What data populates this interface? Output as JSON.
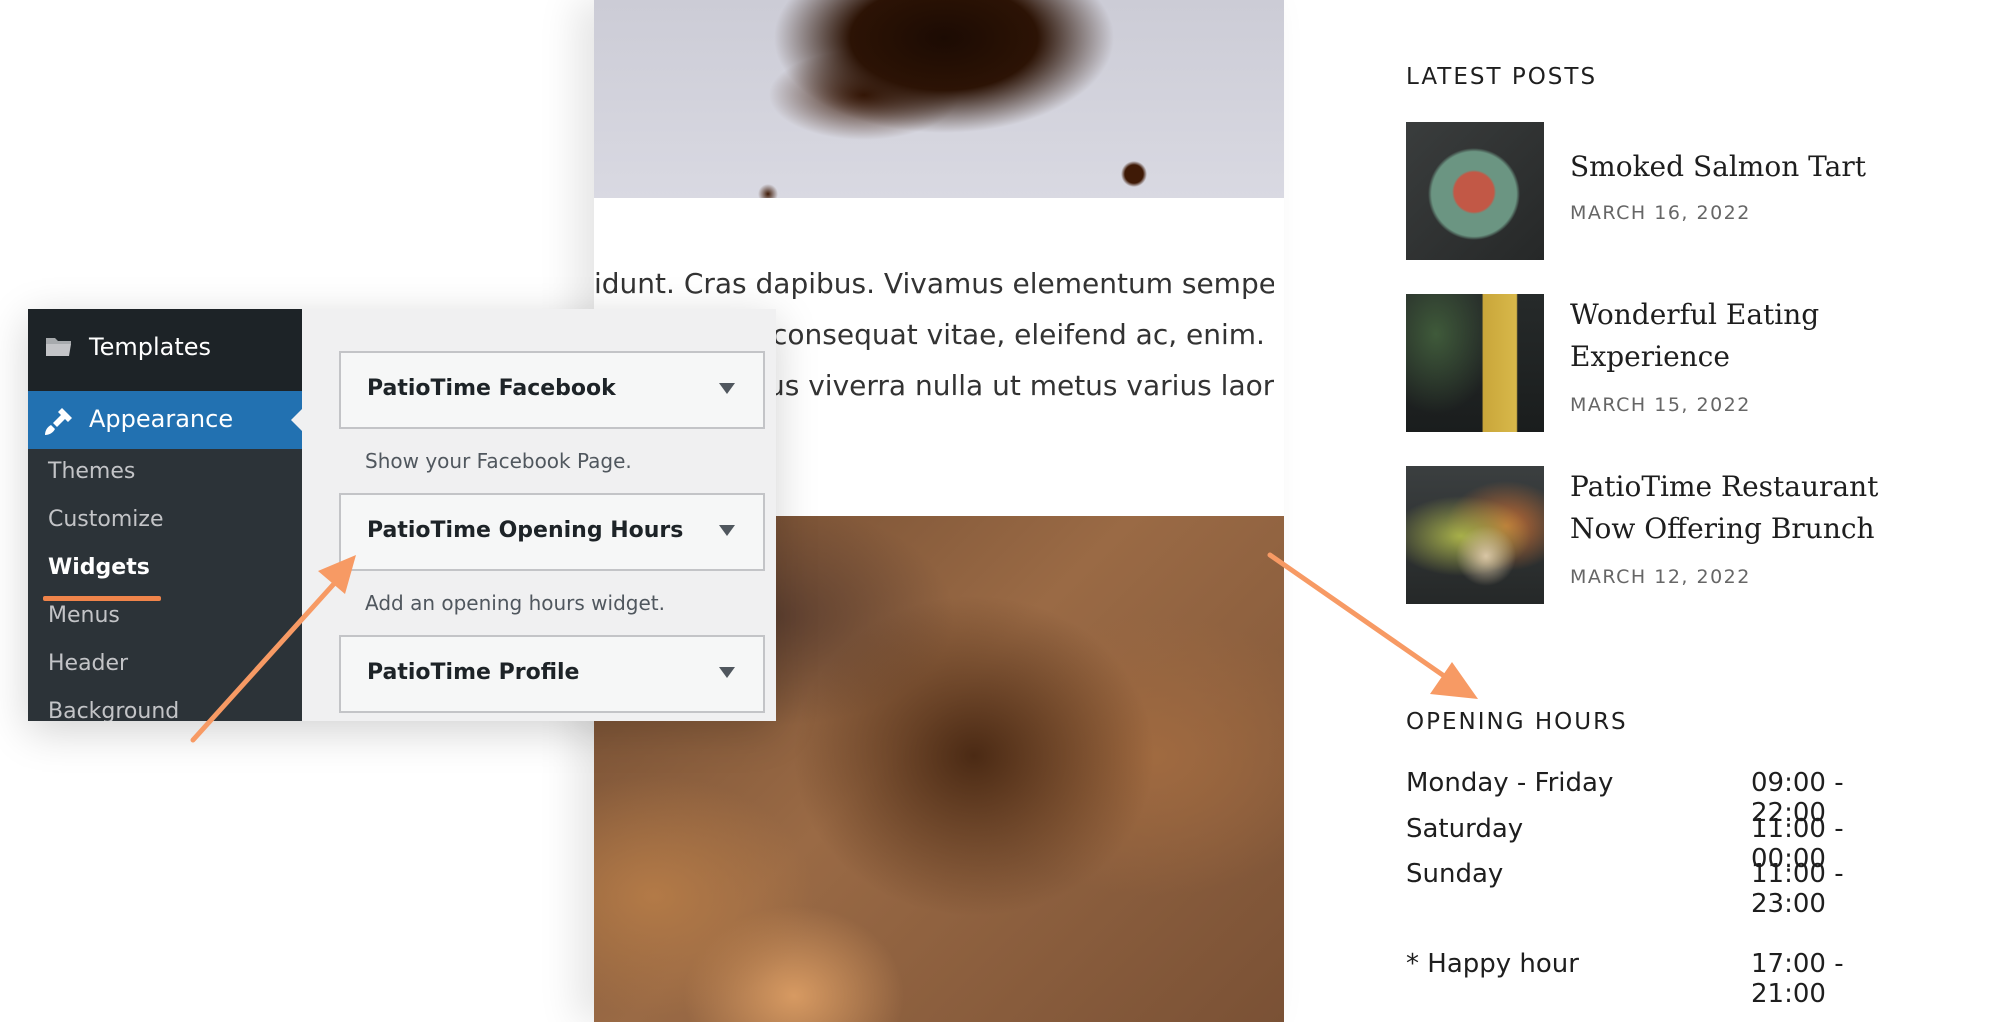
{
  "article": {
    "body_lines": [
      "idunt. Cras dapibus. Vivamus elementum semper",
      "consequat vitae, eleifend ac, enim.",
      "us viverra nulla ut metus varius laoreet."
    ]
  },
  "sidebar": {
    "latest_posts": {
      "title": "LATEST POSTS",
      "posts": [
        {
          "title": "Smoked Salmon Tart",
          "date": "MARCH 16, 2022"
        },
        {
          "title": "Wonderful Eating Experience",
          "date": "MARCH 15, 2022"
        },
        {
          "title": "PatioTime Restaurant Now Offering Brunch",
          "date": "MARCH 12, 2022"
        }
      ]
    },
    "opening_hours": {
      "title": "OPENING HOURS",
      "rows": [
        {
          "day": "Monday - Friday",
          "time": "09:00 - 22:00"
        },
        {
          "day": "Saturday",
          "time": "11:00 - 00:00"
        },
        {
          "day": "Sunday",
          "time": "11:00 - 23:00"
        },
        {
          "day": "* Happy hour",
          "time": "17:00 - 21:00"
        }
      ]
    }
  },
  "admin": {
    "menu": {
      "templates_label": "Templates",
      "templates_icon": "folder-icon",
      "appearance_label": "Appearance",
      "appearance_icon": "paintbrush-icon",
      "submenu": [
        "Themes",
        "Customize",
        "Widgets",
        "Menus",
        "Header",
        "Background"
      ],
      "current_item": "Widgets"
    },
    "widgets": [
      {
        "title": "PatioTime Facebook",
        "description": "Show your Facebook Page."
      },
      {
        "title": "PatioTime Opening Hours",
        "description": "Add an opening hours widget."
      },
      {
        "title": "PatioTime Profile",
        "description": ""
      }
    ]
  },
  "colors": {
    "wp_admin_dark": "#1d2327",
    "wp_admin_menu": "#2c3338",
    "wp_admin_accent": "#2271b1",
    "annotation_orange": "#f79a64"
  }
}
